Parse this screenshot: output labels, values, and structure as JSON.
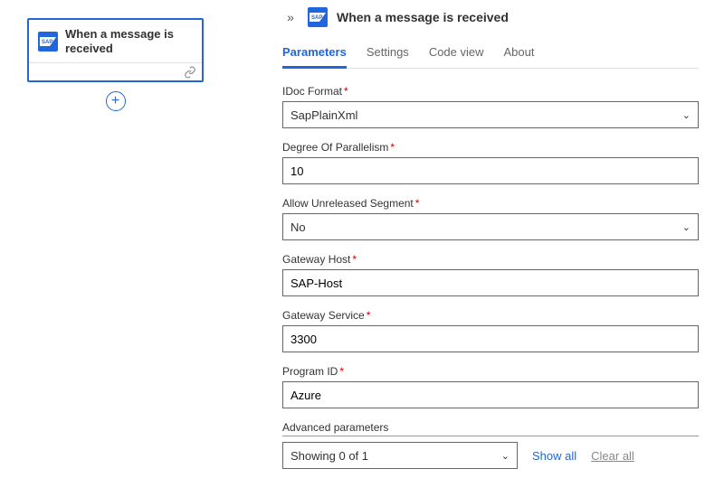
{
  "canvas": {
    "node": {
      "title": "When a message is received",
      "icon": "sap-icon"
    }
  },
  "panel": {
    "title": "When a message is received",
    "tabs": [
      {
        "label": "Parameters",
        "active": true
      },
      {
        "label": "Settings"
      },
      {
        "label": "Code view"
      },
      {
        "label": "About"
      }
    ],
    "fields": {
      "idoc_format": {
        "label": "IDoc Format",
        "required": true,
        "value": "SapPlainXml",
        "type": "select"
      },
      "parallelism": {
        "label": "Degree Of Parallelism",
        "required": true,
        "value": "10",
        "type": "text"
      },
      "allow_unreleased": {
        "label": "Allow Unreleased Segment",
        "required": true,
        "value": "No",
        "type": "select"
      },
      "gateway_host": {
        "label": "Gateway Host",
        "required": true,
        "value": "SAP-Host",
        "type": "text"
      },
      "gateway_service": {
        "label": "Gateway Service",
        "required": true,
        "value": "3300",
        "type": "text"
      },
      "program_id": {
        "label": "Program ID",
        "required": true,
        "value": "Azure",
        "type": "text"
      }
    },
    "advanced": {
      "label": "Advanced parameters",
      "select_value": "Showing 0 of 1",
      "show_all": "Show all",
      "clear_all": "Clear all"
    }
  },
  "glyphs": {
    "required": "*",
    "chevron_down": "⌄",
    "collapse": "»",
    "plus": "+"
  }
}
